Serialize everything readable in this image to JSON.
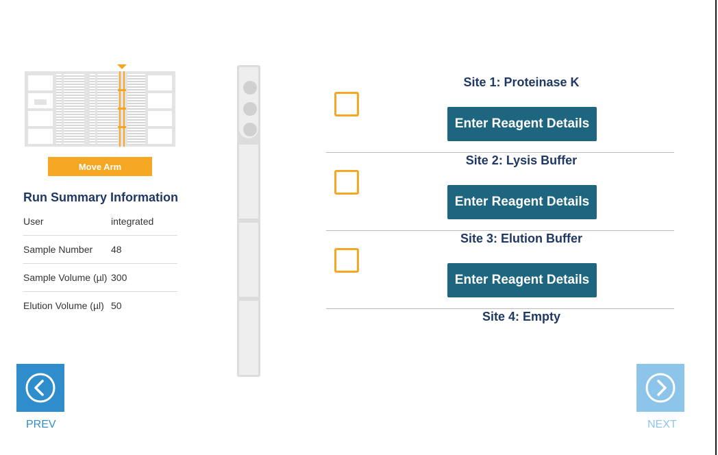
{
  "deck": {
    "move_arm_label": "Move Arm",
    "colors": {
      "arm": "#f5a623",
      "deck": "#e3e3e3"
    }
  },
  "summary": {
    "title": "Run Summary Information",
    "rows": [
      {
        "label": "User",
        "value": "integrated"
      },
      {
        "label": "Sample Number",
        "value": "48"
      },
      {
        "label": "Sample Volume (µl)",
        "value": "300"
      },
      {
        "label": "Elution Volume (µl)",
        "value": "50"
      }
    ]
  },
  "sites": [
    {
      "title": "Site 1: Proteinase K",
      "button": "Enter Reagent Details",
      "checked": false
    },
    {
      "title": "Site 2: Lysis Buffer",
      "button": "Enter Reagent Details",
      "checked": false
    },
    {
      "title": "Site 3: Elution Buffer",
      "button": "Enter Reagent Details",
      "checked": false
    },
    {
      "title": "Site 4: Empty"
    }
  ],
  "nav": {
    "prev_label": "PREV",
    "next_label": "NEXT",
    "prev_icon": "chevron-left-circle-icon",
    "next_icon": "chevron-right-circle-icon"
  },
  "colors": {
    "title_navy": "#1f3864",
    "button_teal": "#1e6680",
    "checkbox_orange": "#f5a623",
    "prev_blue": "#2f8dcc",
    "next_disabled_blue": "#8cc4ea"
  }
}
